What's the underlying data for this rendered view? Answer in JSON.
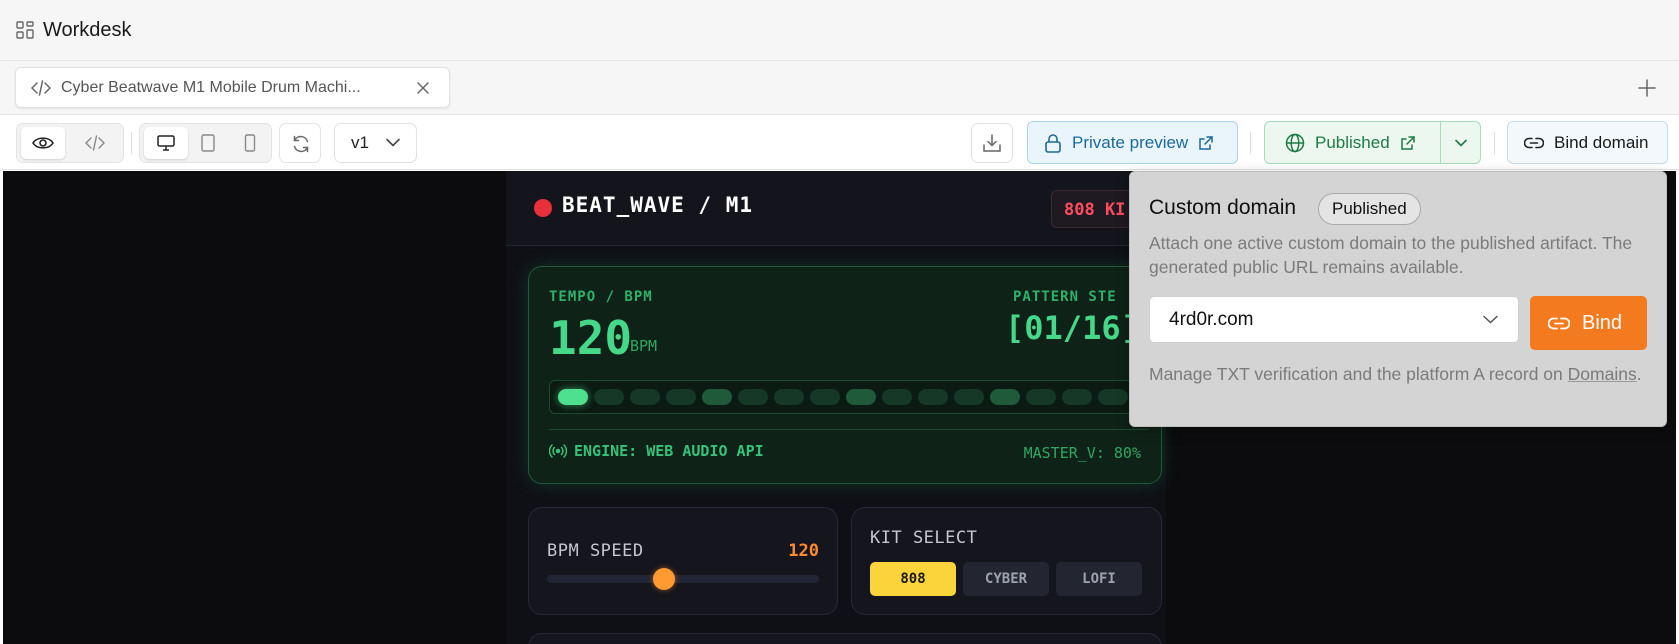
{
  "app": {
    "title": "Workdesk"
  },
  "tab": {
    "label": "Cyber Beatwave M1 Mobile Drum Machi..."
  },
  "toolbar": {
    "version": "v1",
    "private_preview": "Private preview",
    "published": "Published",
    "bind_domain": "Bind domain"
  },
  "drum": {
    "title": "BEAT_WAVE / M1",
    "kit_badge": "808 KI",
    "tempo_label": "TEMPO / BPM",
    "tempo_value": "120",
    "tempo_unit": "BPM",
    "pattern_label": "PATTERN STE",
    "pattern_value": "[01/16]",
    "engine_label": "ENGINE: WEB AUDIO API",
    "master_label": "MASTER_V: 80%",
    "active_step": 1,
    "accent_steps": [
      5,
      9,
      13
    ],
    "step_count": 16,
    "bpm_card": {
      "label": "BPM SPEED",
      "value": "120",
      "slider_fraction": 0.43
    },
    "kit_card": {
      "label": "KIT SELECT",
      "options": [
        "808",
        "CYBER",
        "LOFI"
      ],
      "selected": "808"
    }
  },
  "popover": {
    "title": "Custom domain",
    "badge": "Published",
    "description": "Attach one active custom domain to the published artifact. The generated public URL remains available.",
    "domain_value": "4rd0r.com",
    "bind_label": "Bind",
    "footer_text": "Manage TXT verification and the platform A record on",
    "footer_link": "Domains",
    "footer_end": "."
  },
  "colors": {
    "accent_orange": "#f47a1f",
    "display_green": "#45d889",
    "rec_red": "#e8303a",
    "kit_yellow": "#fbd33a"
  }
}
